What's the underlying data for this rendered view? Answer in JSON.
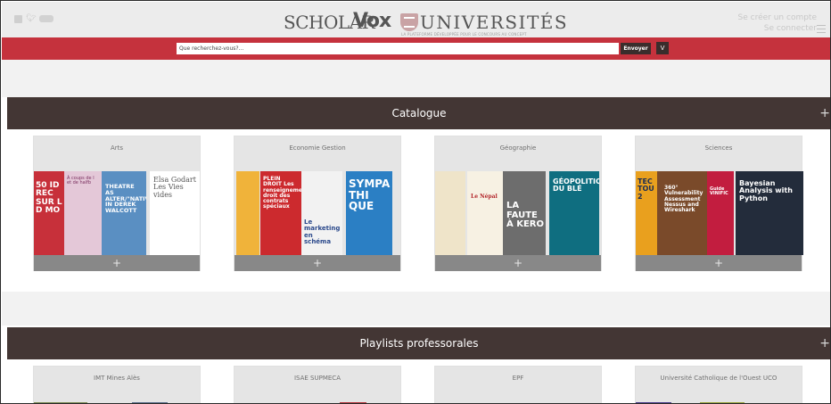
{
  "header": {
    "logo": {
      "part1": "SCHOLAR",
      "part2": "Vox",
      "part3": "UNIVERSITÉS",
      "tagline": "LA PLATEFORME DÉVELOPPÉE POUR LE CONCOURS AU CONCEPT"
    },
    "social_icons": [
      "facebook-icon",
      "twitter-icon",
      "vimeo-icon"
    ],
    "account": {
      "signup": "Se créer un compte",
      "login": "Se connecter"
    },
    "menu_icon": "hamburger-icon"
  },
  "search": {
    "placeholder": "Que recherchez-vous?...",
    "submit_label": "Envoyer",
    "toggle_label": "V"
  },
  "sections": {
    "catalogue": {
      "title": "Catalogue",
      "expand": "+",
      "cards": [
        {
          "title": "Arts",
          "footer": "+",
          "covers": [
            {
              "text": "50 ID REC SUR L D MO",
              "bg": "#c7303a",
              "fg": "#ffffff"
            },
            {
              "text": "À coups de l et de halfb",
              "bg": "#e4c8d8",
              "fg": "#7a2f5f"
            },
            {
              "text": "THEATRE AS ALTER/\"NATIVE\" IN DEREK WALCOTT",
              "bg": "#5a8fc2",
              "fg": "#ffffff"
            },
            {
              "text": "Elsa Godart Les Vies vides",
              "bg": "#ffffff",
              "fg": "#555555"
            }
          ]
        },
        {
          "title": "Economie Gestion",
          "footer": "+",
          "covers": [
            {
              "text": "",
              "bg": "#f0b33a",
              "fg": "#ffffff"
            },
            {
              "text": "PLEIN DROIT Les renseignements droit des contrats spéciaux",
              "bg": "#cc2a2e",
              "fg": "#ffffff"
            },
            {
              "text": "Le marketing en schéma",
              "bg": "#f2f2f2",
              "fg": "#2c4a8c"
            },
            {
              "text": "SYMPA THI QUE",
              "bg": "#2b7fc4",
              "fg": "#ffffff"
            }
          ]
        },
        {
          "title": "Géographie",
          "footer": "+",
          "covers": [
            {
              "text": "",
              "bg": "#efe4c9",
              "fg": "#6a5a3a"
            },
            {
              "text": "Le Népal",
              "bg": "#f7f1e3",
              "fg": "#b3262b"
            },
            {
              "text": "LA FAUTE À KERO",
              "bg": "#6d6d6d",
              "fg": "#ffffff"
            },
            {
              "text": "GÉOPOLITIQUE DU BLÉ",
              "bg": "#0f6e80",
              "fg": "#ffffff"
            }
          ]
        },
        {
          "title": "Sciences",
          "footer": "+",
          "covers": [
            {
              "text": "TEC TOU 2",
              "bg": "#e9a01e",
              "fg": "#1b2d55"
            },
            {
              "text": "360° Vulnerability Assessment Nessus and Wireshark",
              "bg": "#7a4a2a",
              "fg": "#ffffff"
            },
            {
              "text": "Guide VINIFIC",
              "bg": "#c21d3f",
              "fg": "#ffffff"
            },
            {
              "text": "Bayesian Analysis with Python",
              "bg": "#232c3b",
              "fg": "#ffffff"
            }
          ]
        }
      ]
    },
    "playlists": {
      "title": "Playlists professorales",
      "expand": "+",
      "cards": [
        {
          "title": "IMT Mines Alès"
        },
        {
          "title": "ISAE SUPMECA"
        },
        {
          "title": "EPF"
        },
        {
          "title": "Université Catholique de l'Ouest UCO"
        }
      ]
    }
  }
}
